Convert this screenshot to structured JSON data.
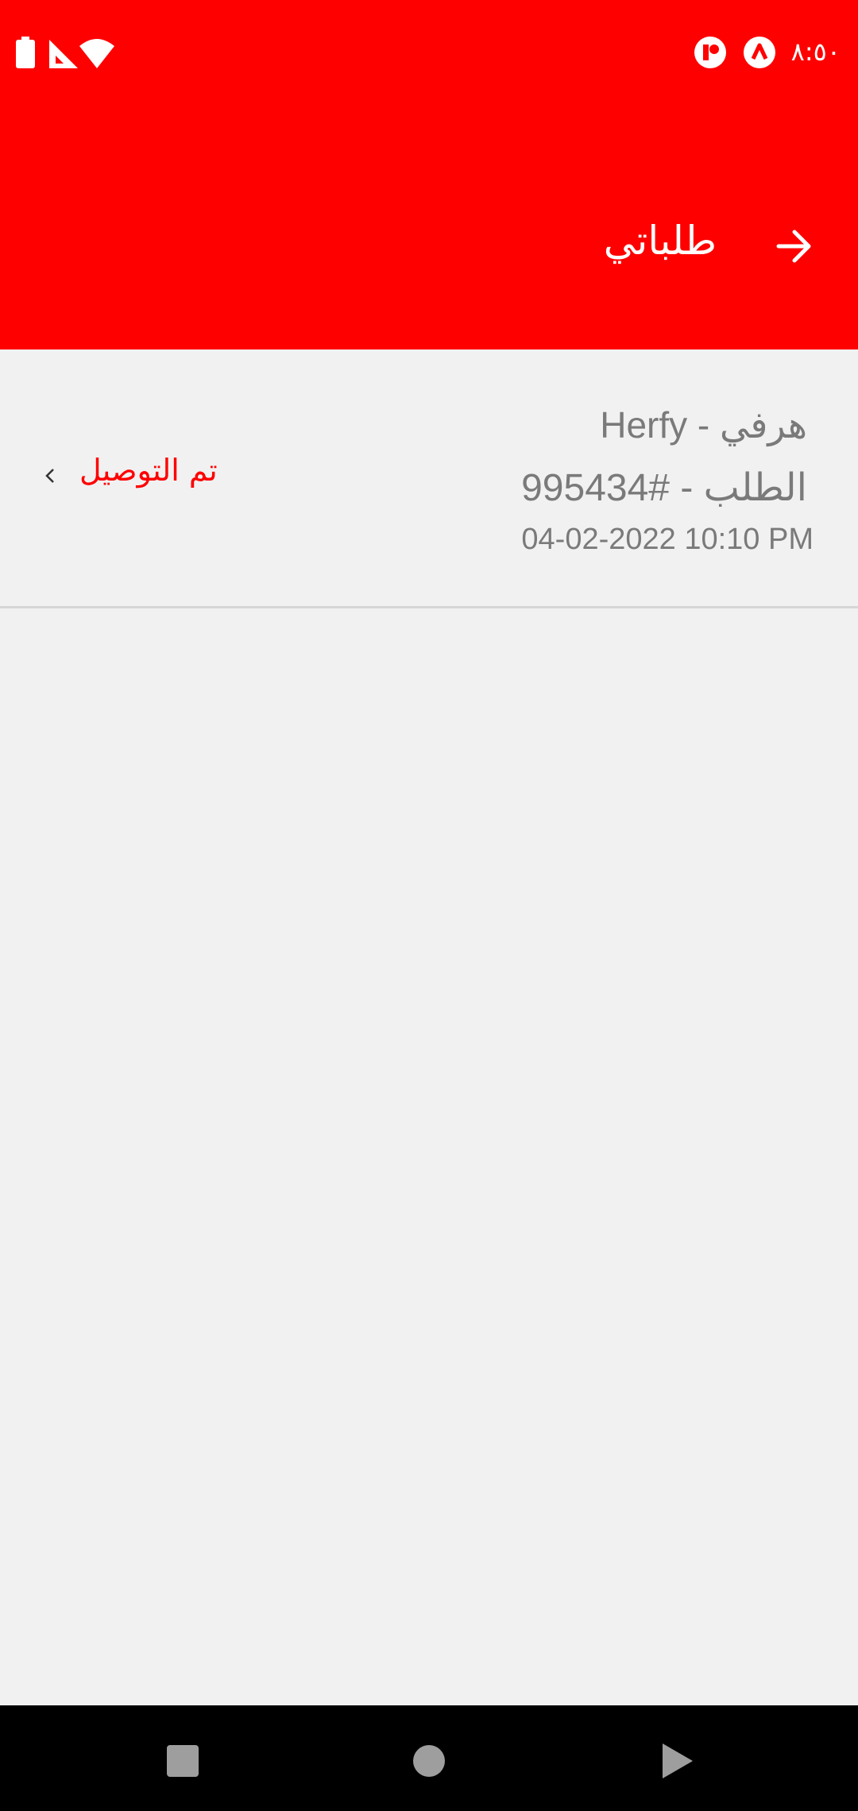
{
  "status_bar": {
    "time": "٨:٥٠",
    "icons": [
      "notification-r-icon",
      "notification-a-icon",
      "wifi-icon",
      "signal-icon",
      "battery-icon"
    ]
  },
  "header": {
    "title": "طلباتي",
    "back_icon": "arrow-right-icon",
    "color": "#ff0000"
  },
  "orders": [
    {
      "restaurant": "Herfy - هرفي",
      "order_number": "الطلب - #995434",
      "date": "04-02-2022 10:10 PM",
      "status": "تم التوصيل",
      "status_color": "#ff0000"
    }
  ],
  "nav_bar": {
    "buttons": [
      "recents-square-icon",
      "home-circle-icon",
      "back-triangle-icon"
    ]
  }
}
